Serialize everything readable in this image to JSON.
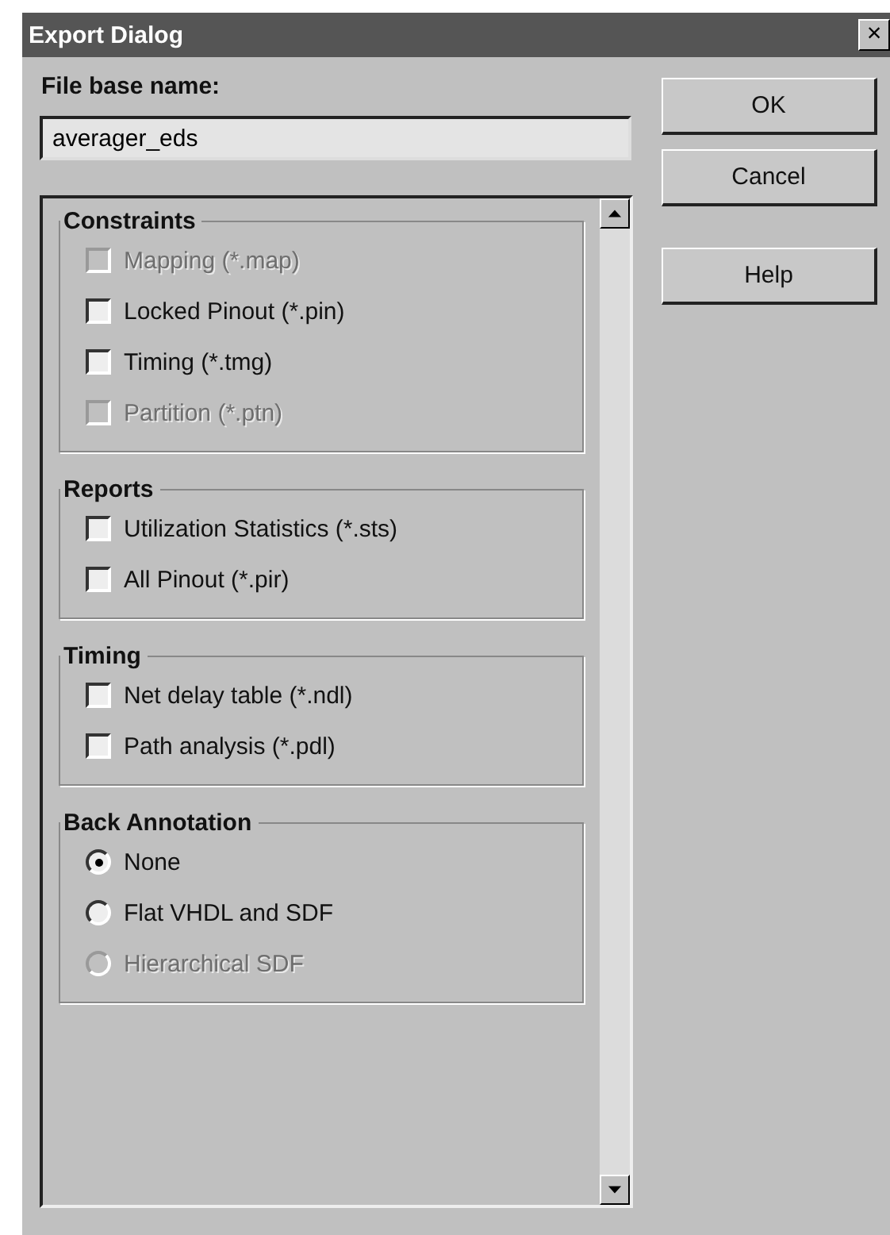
{
  "window": {
    "title": "Export Dialog",
    "close_label": "×"
  },
  "file_base_name": {
    "label": "File base name:",
    "value": "averager_eds"
  },
  "buttons": [
    "OK",
    "Cancel",
    "Help"
  ],
  "groups": [
    {
      "title": "Constraints",
      "items": [
        {
          "kind": "checkbox",
          "label": "Mapping (*.map)",
          "checked": false,
          "disabled": true
        },
        {
          "kind": "checkbox",
          "label": "Locked Pinout (*.pin)",
          "checked": false,
          "disabled": false
        },
        {
          "kind": "checkbox",
          "label": "Timing (*.tmg)",
          "checked": false,
          "disabled": false
        },
        {
          "kind": "checkbox",
          "label": "Partition (*.ptn)",
          "checked": false,
          "disabled": true
        }
      ]
    },
    {
      "title": "Reports",
      "items": [
        {
          "kind": "checkbox",
          "label": "Utilization Statistics (*.sts)",
          "checked": false,
          "disabled": false
        },
        {
          "kind": "checkbox",
          "label": "All Pinout (*.pir)",
          "checked": false,
          "disabled": false
        }
      ]
    },
    {
      "title": "Timing",
      "items": [
        {
          "kind": "checkbox",
          "label": "Net delay table (*.ndl)",
          "checked": false,
          "disabled": false
        },
        {
          "kind": "checkbox",
          "label": "Path analysis (*.pdl)",
          "checked": false,
          "disabled": false
        }
      ]
    },
    {
      "title": "Back Annotation",
      "items": [
        {
          "kind": "radio",
          "label": "None",
          "selected": true,
          "disabled": false
        },
        {
          "kind": "radio",
          "label": "Flat VHDL and SDF",
          "selected": false,
          "disabled": false
        },
        {
          "kind": "radio",
          "label": "Hierarchical SDF",
          "selected": false,
          "disabled": true
        }
      ]
    }
  ]
}
